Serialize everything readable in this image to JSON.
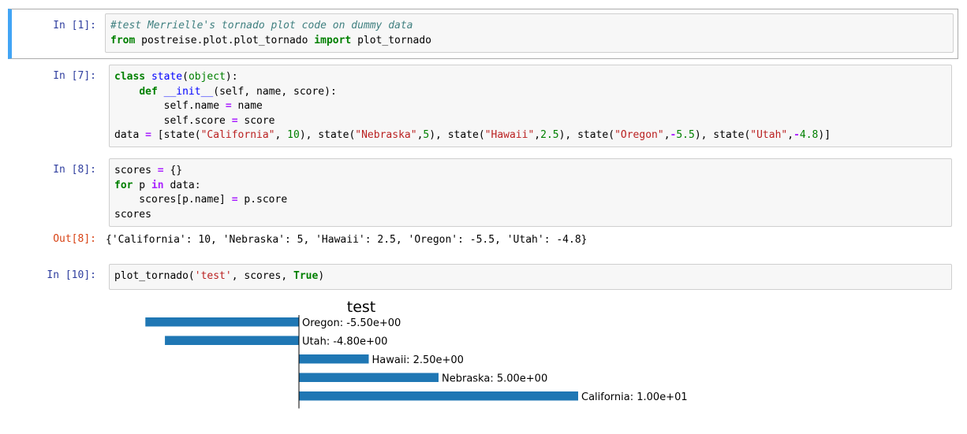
{
  "cells": [
    {
      "prompt": "In [1]:",
      "lines": [
        [
          {
            "t": "#test Merrielle's tornado plot code on dummy data",
            "c": "cm"
          }
        ],
        [
          {
            "t": "from",
            "c": "kw"
          },
          {
            "t": " postreise.plot.plot_tornado ",
            "c": ""
          },
          {
            "t": "import",
            "c": "kw"
          },
          {
            "t": " plot_tornado",
            "c": ""
          }
        ]
      ]
    },
    {
      "prompt": "In [7]:",
      "lines": [
        [
          {
            "t": "class",
            "c": "kw"
          },
          {
            "t": " ",
            "c": ""
          },
          {
            "t": "state",
            "c": "fn"
          },
          {
            "t": "(",
            "c": ""
          },
          {
            "t": "object",
            "c": "bi"
          },
          {
            "t": "):",
            "c": ""
          }
        ],
        [
          {
            "t": "    ",
            "c": ""
          },
          {
            "t": "def",
            "c": "kw"
          },
          {
            "t": " ",
            "c": ""
          },
          {
            "t": "__init__",
            "c": "dunder"
          },
          {
            "t": "(self, name, score):",
            "c": ""
          }
        ],
        [
          {
            "t": "        self.name ",
            "c": ""
          },
          {
            "t": "=",
            "c": "op"
          },
          {
            "t": " name",
            "c": ""
          }
        ],
        [
          {
            "t": "        self.score ",
            "c": ""
          },
          {
            "t": "=",
            "c": "op"
          },
          {
            "t": " score",
            "c": ""
          }
        ],
        [
          {
            "t": "data ",
            "c": ""
          },
          {
            "t": "=",
            "c": "op"
          },
          {
            "t": " [state(",
            "c": ""
          },
          {
            "t": "\"California\"",
            "c": "str"
          },
          {
            "t": ", ",
            "c": ""
          },
          {
            "t": "10",
            "c": "num"
          },
          {
            "t": "), state(",
            "c": ""
          },
          {
            "t": "\"Nebraska\"",
            "c": "str"
          },
          {
            "t": ",",
            "c": ""
          },
          {
            "t": "5",
            "c": "num"
          },
          {
            "t": "), state(",
            "c": ""
          },
          {
            "t": "\"Hawaii\"",
            "c": "str"
          },
          {
            "t": ",",
            "c": ""
          },
          {
            "t": "2.5",
            "c": "num"
          },
          {
            "t": "), state(",
            "c": ""
          },
          {
            "t": "\"Oregon\"",
            "c": "str"
          },
          {
            "t": ",",
            "c": ""
          },
          {
            "t": "-",
            "c": "op"
          },
          {
            "t": "5.5",
            "c": "num"
          },
          {
            "t": "), state(",
            "c": ""
          },
          {
            "t": "\"Utah\"",
            "c": "str"
          },
          {
            "t": ",",
            "c": ""
          },
          {
            "t": "-",
            "c": "op"
          },
          {
            "t": "4.8",
            "c": "num"
          },
          {
            "t": ")]",
            "c": ""
          }
        ]
      ]
    },
    {
      "prompt": "In [8]:",
      "lines": [
        [
          {
            "t": "scores ",
            "c": ""
          },
          {
            "t": "=",
            "c": "op"
          },
          {
            "t": " {}",
            "c": ""
          }
        ],
        [
          {
            "t": "for",
            "c": "kw"
          },
          {
            "t": " p ",
            "c": ""
          },
          {
            "t": "in",
            "c": "op"
          },
          {
            "t": " data:",
            "c": ""
          }
        ],
        [
          {
            "t": "    scores[p.name] ",
            "c": ""
          },
          {
            "t": "=",
            "c": "op"
          },
          {
            "t": " p.score",
            "c": ""
          }
        ],
        [
          {
            "t": "scores",
            "c": ""
          }
        ]
      ],
      "out_prompt": "Out[8]:",
      "output": "{'California': 10, 'Nebraska': 5, 'Hawaii': 2.5, 'Oregon': -5.5, 'Utah': -4.8}"
    },
    {
      "prompt": "In [10]:",
      "lines": [
        [
          {
            "t": "plot_tornado(",
            "c": ""
          },
          {
            "t": "'test'",
            "c": "str"
          },
          {
            "t": ", scores, ",
            "c": ""
          },
          {
            "t": "True",
            "c": "kw"
          },
          {
            "t": ")",
            "c": ""
          }
        ]
      ]
    }
  ],
  "chart_data": {
    "type": "bar",
    "orientation": "horizontal",
    "title": "test",
    "categories": [
      "Oregon",
      "Utah",
      "Hawaii",
      "Nebraska",
      "California"
    ],
    "values": [
      -5.5,
      -4.8,
      2.5,
      5.0,
      10.0
    ],
    "labels": [
      "Oregon: -5.50e+00",
      "Utah: -4.80e+00",
      "Hawaii: 2.50e+00",
      "Nebraska: 5.00e+00",
      "California: 1.00e+01"
    ],
    "bar_color": "#1f77b4",
    "xlim": [
      -5.5,
      10
    ],
    "axis": "off"
  }
}
